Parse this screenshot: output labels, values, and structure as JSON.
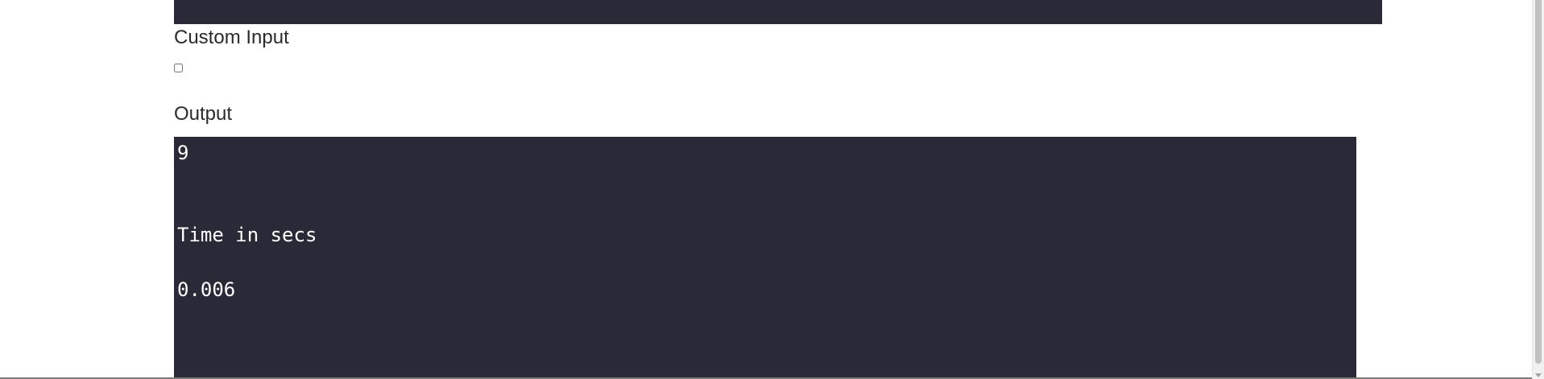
{
  "custom_input": {
    "label": "Custom Input",
    "checked": false
  },
  "output": {
    "label": "Output",
    "result": "9",
    "time_label": "Time in secs",
    "time_value": "0.006"
  },
  "colors": {
    "panel_background": "#2a2937",
    "panel_text": "#ffffff",
    "label_text": "#2b2b2b"
  }
}
